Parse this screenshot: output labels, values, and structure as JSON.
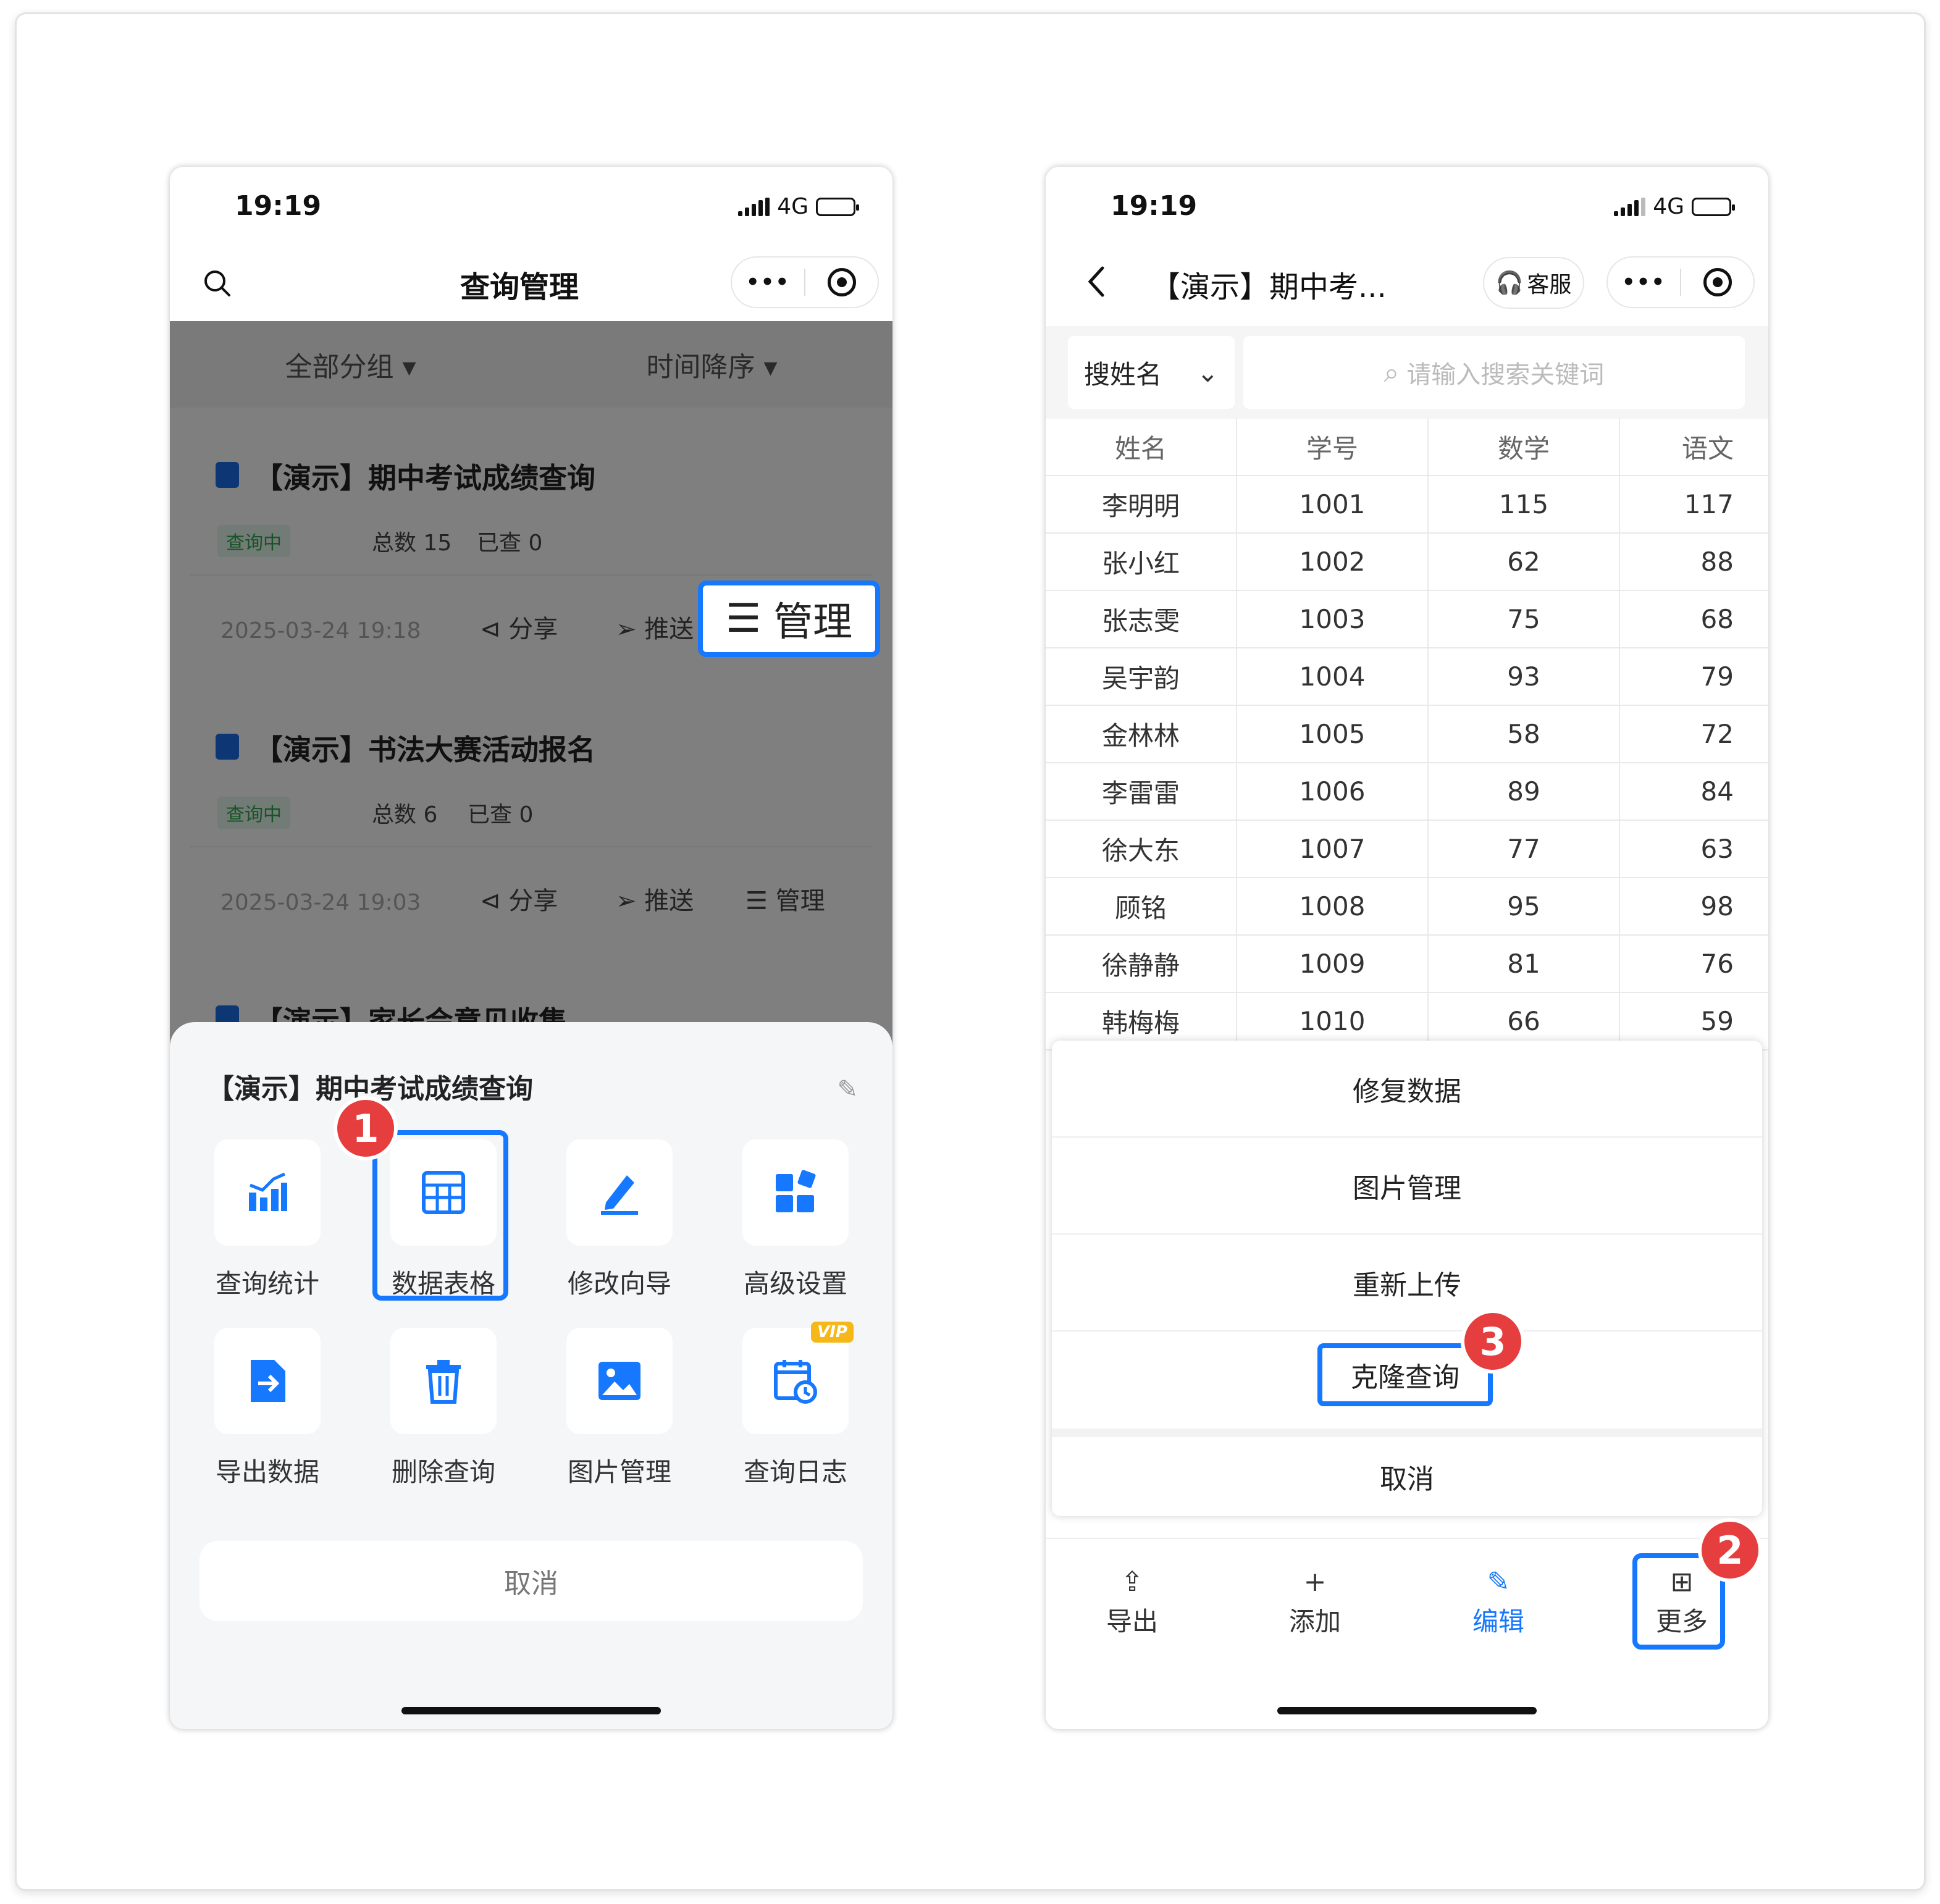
{
  "left": {
    "status": {
      "time": "19:19",
      "network": "4G"
    },
    "nav": {
      "title": "查询管理"
    },
    "filters": {
      "group": "全部分组 ▾",
      "sort": "时间降序 ▾"
    },
    "cards": [
      {
        "title": "【演示】期中考试成绩查询",
        "status": "查询中",
        "total": "总数 15",
        "checked": "已查 0",
        "date": "2025-03-24 19:18",
        "share": "分享",
        "push": "推送",
        "manage": "管理"
      },
      {
        "title": "【演示】书法大赛活动报名",
        "status": "查询中",
        "total": "总数 6",
        "checked": "已查 0",
        "date": "2025-03-24 19:03",
        "share": "分享",
        "push": "推送",
        "manage": "管理"
      },
      {
        "title": "【演示】家长会意见收集"
      }
    ],
    "manage_highlight": "管理",
    "sheet": {
      "title": "【演示】期中考试成绩查询",
      "items": [
        "查询统计",
        "数据表格",
        "修改向导",
        "高级设置",
        "导出数据",
        "删除查询",
        "图片管理",
        "查询日志"
      ],
      "vip": "VIP",
      "cancel": "取消"
    }
  },
  "right": {
    "status": {
      "time": "19:19",
      "network": "4G"
    },
    "nav": {
      "title": "【演示】期中考...",
      "service": "客服"
    },
    "search": {
      "field": "搜姓名",
      "placeholder": "请输入搜索关键词"
    },
    "table": {
      "headers": [
        "姓名",
        "学号",
        "数学",
        "语文"
      ],
      "rows": [
        [
          "李明明",
          "1001",
          "115",
          "117"
        ],
        [
          "张小红",
          "1002",
          "62",
          "88"
        ],
        [
          "张志雯",
          "1003",
          "75",
          "68"
        ],
        [
          "吴宇韵",
          "1004",
          "93",
          "79"
        ],
        [
          "金林林",
          "1005",
          "58",
          "72"
        ],
        [
          "李雷雷",
          "1006",
          "89",
          "84"
        ],
        [
          "徐大东",
          "1007",
          "77",
          "63"
        ],
        [
          "顾铭",
          "1008",
          "95",
          "98"
        ],
        [
          "徐静静",
          "1009",
          "81",
          "76"
        ],
        [
          "韩梅梅",
          "1010",
          "66",
          "59"
        ]
      ]
    },
    "menu": [
      "修复数据",
      "图片管理",
      "重新上传",
      "克隆查询",
      "取消"
    ],
    "tabs": [
      "导出",
      "添加",
      "编辑",
      "更多"
    ]
  },
  "markers": [
    "1",
    "2",
    "3"
  ],
  "colors": {
    "accent": "#1677ff",
    "marker": "#e63e3e",
    "badge": "#2aa84f"
  }
}
